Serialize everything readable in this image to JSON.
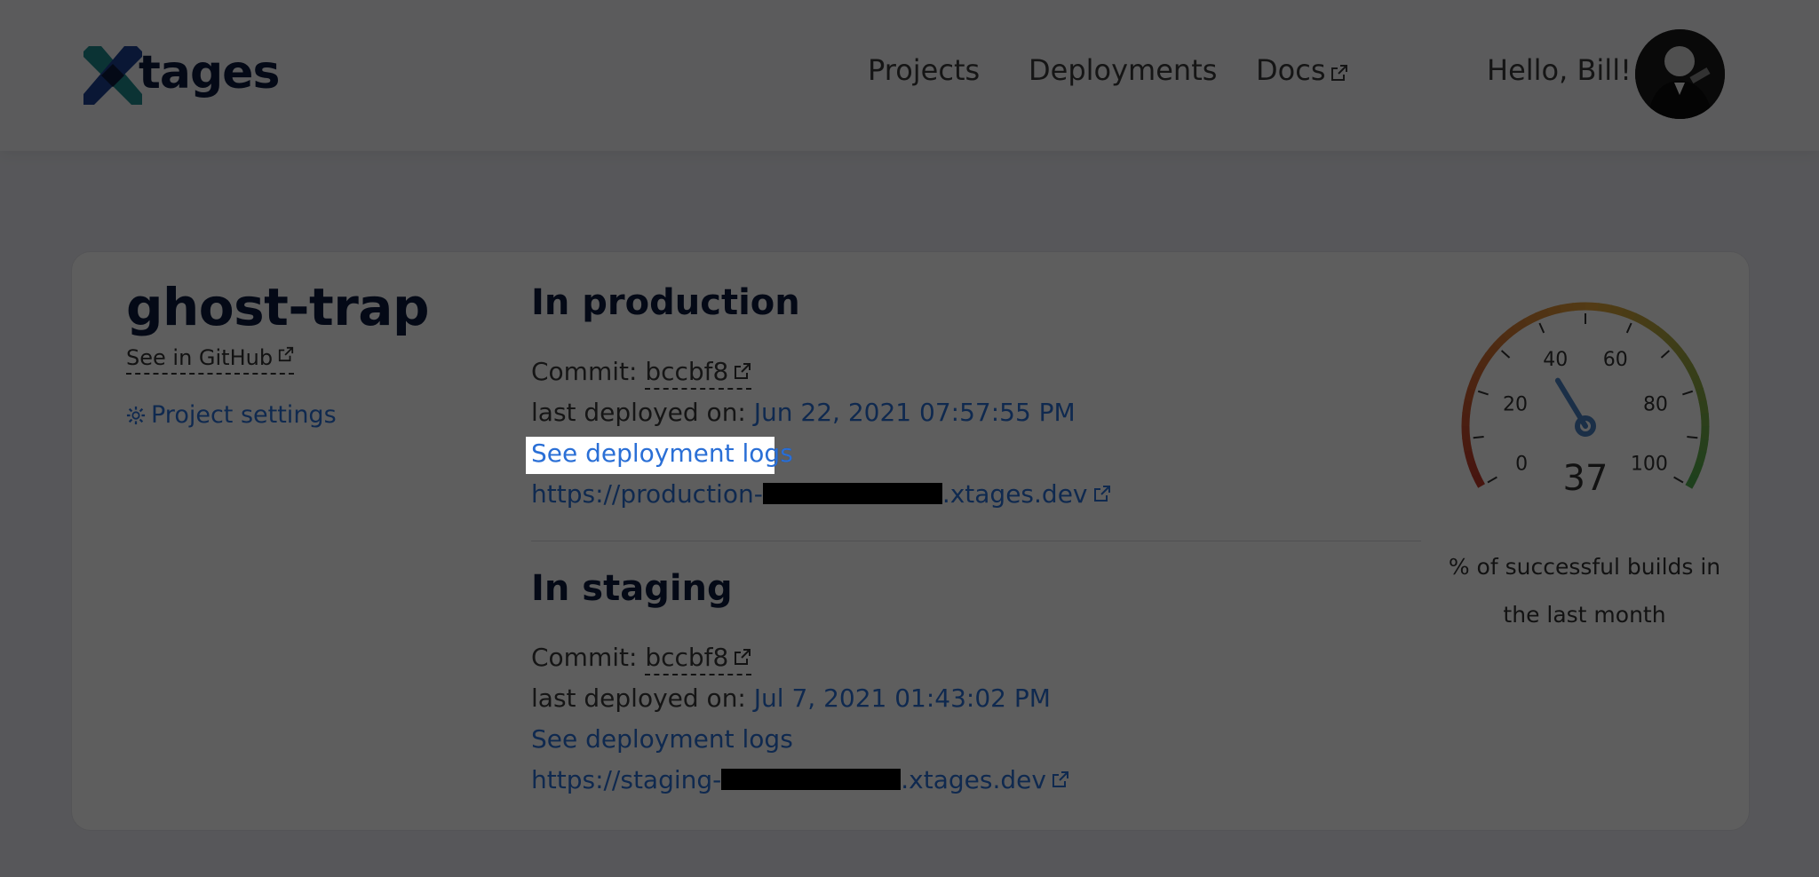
{
  "header": {
    "logo_text": "tages",
    "nav": [
      {
        "label": "Projects"
      },
      {
        "label": "Deployments"
      },
      {
        "label": "Docs"
      }
    ],
    "greeting": "Hello, Bill!"
  },
  "project": {
    "name": "ghost-trap",
    "github_label": "See in GitHub",
    "settings_label": "Project settings"
  },
  "production": {
    "title": "In production",
    "commit_label": "Commit:",
    "commit_sha": "bccbf8",
    "deployed_label": "last deployed on:",
    "deployed_on": "Jun 22, 2021 07:57:55 PM",
    "logs_label": "See deployment logs",
    "url_prefix": "https://production-",
    "url_suffix": ".xtages.dev"
  },
  "staging": {
    "title": "In staging",
    "commit_label": "Commit:",
    "commit_sha": "bccbf8",
    "deployed_label": "last deployed on:",
    "deployed_on": "Jul 7, 2021 01:43:02 PM",
    "logs_label": "See deployment logs",
    "url_prefix": "https://staging-",
    "url_suffix": ".xtages.dev"
  },
  "gauge": {
    "value": 37,
    "min": 0,
    "max": 100,
    "tick_labels": [
      "0",
      "20",
      "40",
      "60",
      "80",
      "100"
    ],
    "caption_line1": "% of successful builds in",
    "caption_line2": "the last month"
  },
  "colors": {
    "brand_navy": "#0d1a3d",
    "link_blue": "#2a6fd6",
    "logo_teal": "#1f8b8e",
    "logo_blue": "#1b3f8f"
  }
}
